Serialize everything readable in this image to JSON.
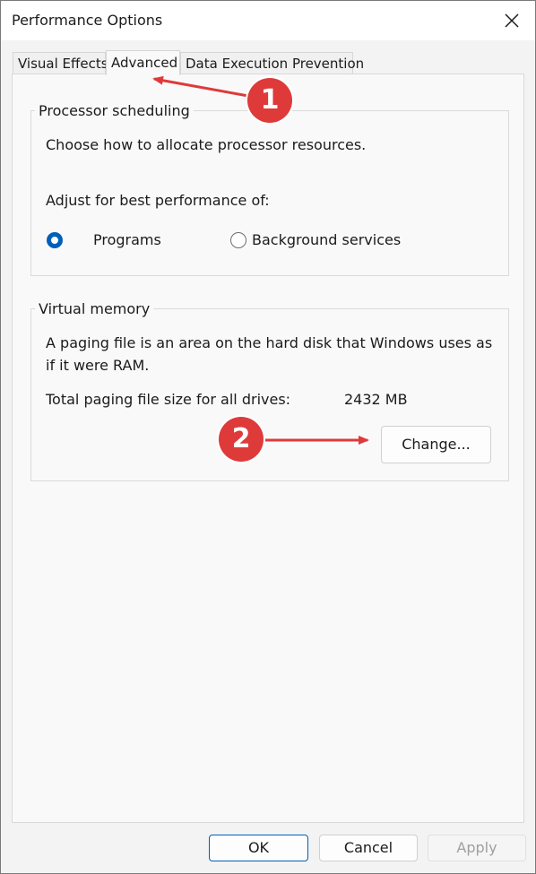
{
  "window": {
    "title": "Performance Options"
  },
  "tabs": [
    {
      "label": "Visual Effects"
    },
    {
      "label": "Advanced"
    },
    {
      "label": "Data Execution Prevention"
    }
  ],
  "processor": {
    "group_label": "Processor scheduling",
    "description": "Choose how to allocate processor resources.",
    "adjust_label": "Adjust for best performance of:",
    "options": [
      {
        "label": "Programs",
        "selected": true
      },
      {
        "label": "Background services",
        "selected": false
      }
    ]
  },
  "virtual_memory": {
    "group_label": "Virtual memory",
    "description_line1": "A paging file is an area on the hard disk that Windows uses as",
    "description_line2": "if it were RAM.",
    "total_label": "Total paging file size for all drives:",
    "total_value": "2432 MB",
    "change_button": "Change..."
  },
  "footer": {
    "ok": "OK",
    "cancel": "Cancel",
    "apply": "Apply"
  },
  "annotations": [
    {
      "number": "1"
    },
    {
      "number": "2"
    }
  ],
  "colors": {
    "annotation": "#de3a3a",
    "accent": "#005fb8"
  }
}
